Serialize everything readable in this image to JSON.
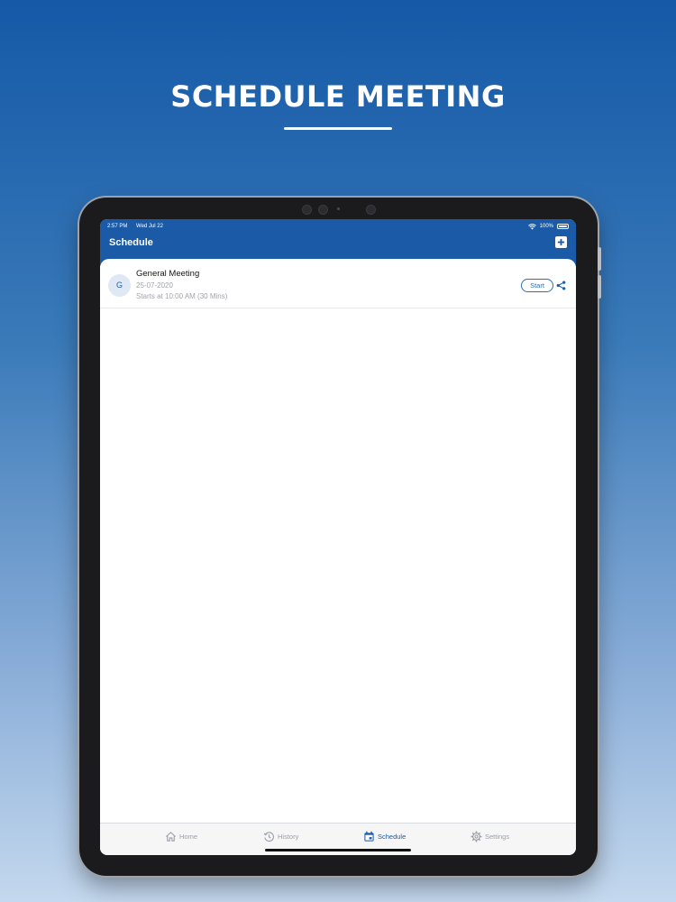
{
  "promo": {
    "headline": "SCHEDULE MEETING"
  },
  "status_bar": {
    "time": "2:57 PM",
    "date": "Wed Jul 22",
    "battery": "100%"
  },
  "header": {
    "title": "Schedule",
    "add_icon": "plus-square-icon"
  },
  "meetings": [
    {
      "avatar_letter": "G",
      "title": "General Meeting",
      "date": "25-07-2020",
      "time": "Starts at 10:00 AM (30 Mins)",
      "start_label": "Start",
      "share_icon": "share-icon"
    }
  ],
  "tabs": [
    {
      "label": "Home",
      "icon": "home-icon",
      "active": false
    },
    {
      "label": "History",
      "icon": "history-icon",
      "active": false
    },
    {
      "label": "Schedule",
      "icon": "calendar-icon",
      "active": true
    },
    {
      "label": "Settings",
      "icon": "gear-icon",
      "active": false
    }
  ],
  "colors": {
    "brand": "#1a5aa7",
    "accent": "#2b6db4",
    "inactive_tab": "#9b9fa6"
  }
}
